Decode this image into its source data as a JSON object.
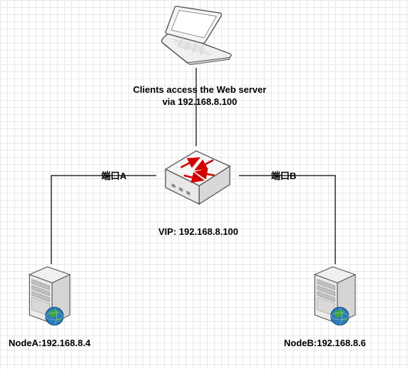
{
  "clients_label_line1": "Clients access the Web server",
  "clients_label_line2": "via 192.168.8.100",
  "vip_label": "VIP: 192.168.8.100",
  "port_a_label": "端口A",
  "port_b_label": "端口B",
  "node_a_label": "NodeA:192.168.8.4",
  "node_b_label": "NodeB:192.168.8.6",
  "icons": {
    "laptop": "laptop-icon",
    "switch": "switch-icon",
    "server": "server-icon"
  }
}
